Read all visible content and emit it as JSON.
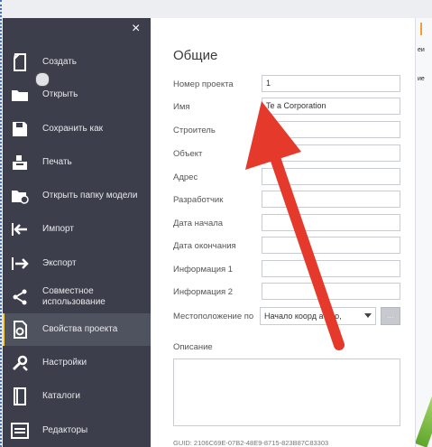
{
  "window": {
    "close_symbol": "×"
  },
  "sidebar": {
    "items": [
      {
        "label": "Создать",
        "icon": "new-document-icon"
      },
      {
        "label": "Открыть",
        "icon": "folder-icon"
      },
      {
        "label": "Сохранить как",
        "icon": "save-icon"
      },
      {
        "label": "Печать",
        "icon": "print-icon"
      },
      {
        "label": "Открыть папку модели",
        "icon": "open-model-folder-icon"
      },
      {
        "label": "Импорт",
        "icon": "import-icon"
      },
      {
        "label": "Экспорт",
        "icon": "export-icon"
      },
      {
        "label": "Совместное использование",
        "icon": "share-icon"
      },
      {
        "label": "Свойства проекта",
        "icon": "project-properties-icon",
        "active": true
      },
      {
        "label": "Настройки",
        "icon": "settings-icon"
      },
      {
        "label": "Каталоги",
        "icon": "catalogs-icon"
      },
      {
        "label": "Редакторы",
        "icon": "editors-icon"
      }
    ]
  },
  "panel": {
    "title": "Общие",
    "fields": [
      {
        "label": "Номер проекта",
        "value": "1"
      },
      {
        "label": "Имя",
        "value": "Te a Corporation"
      },
      {
        "label": "Строитель",
        "value": ""
      },
      {
        "label": "Объект",
        "value": ""
      },
      {
        "label": "Адрес",
        "value": ""
      },
      {
        "label": "Разработчик",
        "value": ""
      },
      {
        "label": "Дата начала",
        "value": ""
      },
      {
        "label": "Дата окончания",
        "value": ""
      },
      {
        "label": "Информация 1",
        "value": ""
      },
      {
        "label": "Информация 2",
        "value": ""
      }
    ],
    "location_label": "Местоположение по",
    "location_value": "Начало коорд    ат мо,",
    "browse_label": "...",
    "description_label": "Описание",
    "description_value": "",
    "guid": "GUID: 2106C69E-07B2-48E9-8715-823B87C83303"
  },
  "right_strip": {
    "text1": "еи",
    "text2": "ие"
  },
  "colors": {
    "sidebar_bg": "#3c3f4b",
    "active_item_bg": "#4f5360",
    "active_marker": "#ffd23c",
    "annotation_arrow": "#e53a2b"
  }
}
